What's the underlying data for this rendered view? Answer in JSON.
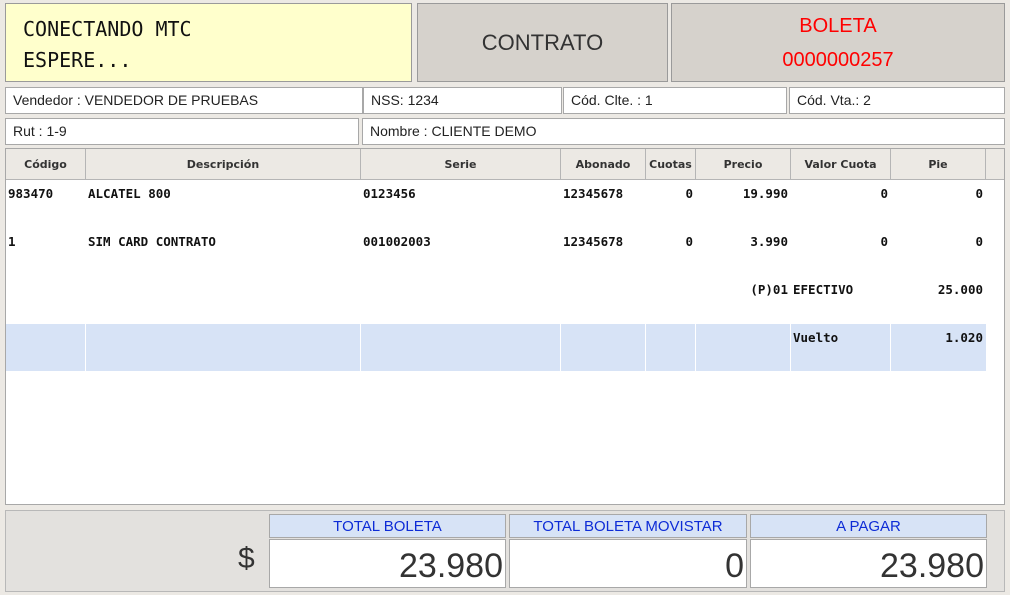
{
  "status": {
    "line1": "CONECTANDO MTC",
    "line2": "ESPERE..."
  },
  "mode_label": "CONTRATO",
  "boleta": {
    "label": "BOLETA",
    "number": "0000000257"
  },
  "info": {
    "vendedor": "Vendedor : VENDEDOR DE PRUEBAS",
    "nss": "NSS: 1234",
    "cod_clte": "Cód. Clte. : 1",
    "cod_vta": "Cód. Vta.: 2",
    "rut": "Rut : 1-9",
    "nombre": "Nombre : CLIENTE DEMO"
  },
  "table": {
    "headers": [
      "Código",
      "Descripción",
      "Serie",
      "Abonado",
      "Cuotas",
      "Precio",
      "Valor Cuota",
      "Pie"
    ],
    "rows": [
      {
        "codigo": "983470",
        "descripcion": "ALCATEL 800",
        "serie": "0123456",
        "abonado": "12345678",
        "cuotas": "0",
        "precio": "19.990",
        "valor_cuota": "0",
        "pie": "0"
      },
      {
        "codigo": "1",
        "descripcion": "SIM CARD CONTRATO",
        "serie": "001002003",
        "abonado": "12345678",
        "cuotas": "0",
        "precio": "3.990",
        "valor_cuota": "0",
        "pie": "0"
      }
    ],
    "payment": {
      "code": "(P)01",
      "method": "EFECTIVO",
      "amount": "25.000"
    },
    "change": {
      "label": "Vuelto",
      "amount": "1.020"
    }
  },
  "totals": {
    "currency": "$",
    "total_boleta": {
      "label": "TOTAL BOLETA",
      "value": "23.980"
    },
    "total_movistar": {
      "label": "TOTAL BOLETA MOVISTAR",
      "value": "0"
    },
    "a_pagar": {
      "label": "A PAGAR",
      "value": "23.980"
    }
  }
}
